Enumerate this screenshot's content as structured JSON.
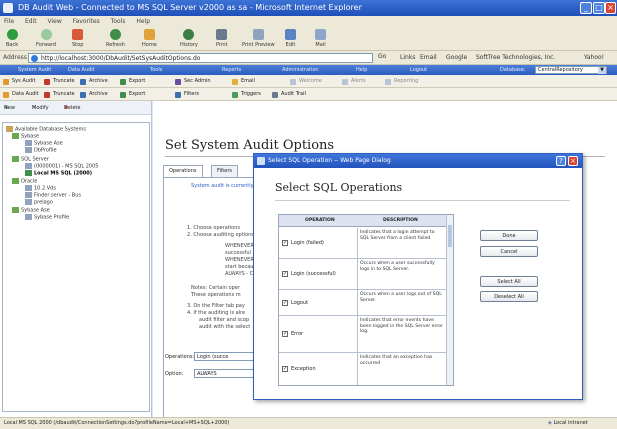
{
  "window": {
    "title": "DB Audit Web - Connected to MS SQL Server v2000 as sa - Microsoft Internet Explorer"
  },
  "menu": [
    "File",
    "Edit",
    "View",
    "Favorites",
    "Tools",
    "Help"
  ],
  "toolbar": {
    "back": "Back",
    "forward": "Forward",
    "stop": "Stop",
    "refresh": "Refresh",
    "home": "Home",
    "history": "History",
    "print": "Print",
    "print_preview": "Print Preview",
    "edit": "Edit",
    "mail": "Mail"
  },
  "address": {
    "label": "Address",
    "url": "http://localhost:3000/DbAudit/SetSysAuditOptions.do",
    "go": "Go",
    "links": [
      "Links",
      "Email",
      "Google",
      "SoftTree Technologies, Inc.",
      "Yahoo!"
    ]
  },
  "nav": {
    "items": [
      "System Audit",
      "Data Audit",
      "Tools",
      "Reports",
      "Administration",
      "Help",
      "Logout"
    ],
    "database_label": "Database:",
    "database_value": "CentralRepository"
  },
  "bar2": [
    "Sys Audit",
    "Truncate",
    "Archive",
    "Export",
    "Sec Admin",
    "Email",
    "Welcome",
    "Alerts",
    "Reporting"
  ],
  "bar3": [
    "Data Audit",
    "Truncate",
    "Archive",
    "Export",
    "Filters",
    "Triggers",
    "Audit Trail"
  ],
  "leftpane": {
    "tool_new": "New",
    "tool_modify": "Modify",
    "tool_delete": "Delete",
    "tree": [
      "Available Database Systems",
      "Sybase",
      "Sybase Ase",
      "DbProfile",
      "SQL Server",
      "(0000001) - MS SQL 2005",
      "Local MS SQL (2000)",
      "Oracle",
      "10.2 Vds",
      "Finder server - Bus",
      "prelago",
      "Sybase Ase",
      "Sybase Profile"
    ]
  },
  "main": {
    "title": "Set System Audit Options",
    "tabs": [
      "Operations",
      "Filters"
    ],
    "status_line": "System audit is currently",
    "instructions": [
      "1.  Choose operations",
      "2.  Choose auditing options",
      "WHENEVER",
      "successful",
      "WHENEVER",
      "start because",
      "ALWAYS - C",
      "Notes: Certain oper",
      "These operations m",
      "3.  On the Filter tab pay",
      "4.  If the auditing is alre",
      "audit filter and scop",
      "audit with the select"
    ],
    "operations_label": "Operations:",
    "operations_value": "Login (succe",
    "option_label": "Option:",
    "option_value": "ALWAYS"
  },
  "dialog": {
    "title": "Select SQL Operation -- Web Page Dialog",
    "heading": "Select SQL Operations",
    "col_operation": "OPERATION",
    "col_description": "DESCRIPTION",
    "rows": [
      {
        "name": "Login (failed)",
        "desc": "Indicates that a login attempt to SQL Server from a client failed."
      },
      {
        "name": "Login (successful)",
        "desc": "Occurs when a user successfully logs in to SQL Server."
      },
      {
        "name": "Logout",
        "desc": "Occurs when a user logs out of SQL Server."
      },
      {
        "name": "Error",
        "desc": "Indicates that error events have been logged in the SQL Server error log."
      },
      {
        "name": "Exception",
        "desc": "Indicates that an exception has occurred"
      }
    ],
    "buttons": [
      "Done",
      "Cancel",
      "Select All",
      "Deselect All"
    ]
  },
  "statusbar": {
    "text": "Local MS SQL 2000 (/dbaudit/ConnectionSettings.do?profileName=Local+MS+SQL+2000)",
    "zone": "Local intranet"
  },
  "colors": {
    "accent": "#2b5cbf",
    "title_bar": "#2353bd",
    "close": "#d9452f"
  }
}
